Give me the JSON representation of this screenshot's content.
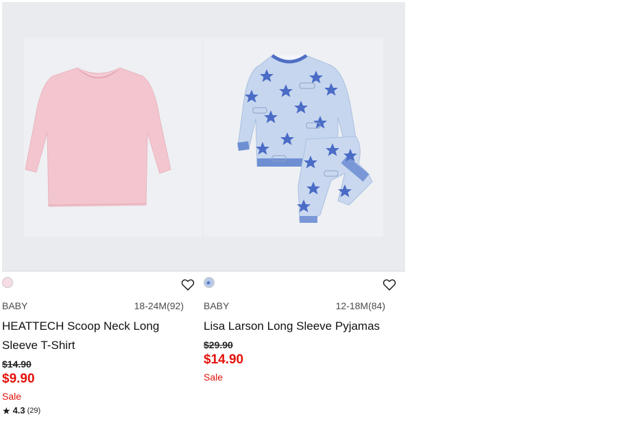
{
  "products": [
    {
      "swatch_color": "#f6dde3",
      "gender": "BABY",
      "size_range": "18-24M(92)",
      "name": "HEATTECH Scoop Neck Long Sleeve T-Shirt",
      "original_price": "$14.90",
      "sale_price": "$9.90",
      "sale_label": "Sale",
      "rating": {
        "score": "4.3",
        "count": "(29)"
      },
      "image_icon": "pink-long-sleeve-tshirt-image",
      "wishlist_icon": "heart-outline-icon"
    },
    {
      "swatch_color": "#b9cbe8",
      "gender": "BABY",
      "size_range": "12-18M(84)",
      "name": "Lisa Larson Long Sleeve Pyjamas",
      "original_price": "$29.90",
      "sale_price": "$14.90",
      "sale_label": "Sale",
      "image_icon": "star-print-pyjamas-image",
      "wishlist_icon": "heart-outline-icon"
    }
  ],
  "colors": {
    "sale_red": "#e3120b",
    "image_bg": "#e9ebee"
  }
}
